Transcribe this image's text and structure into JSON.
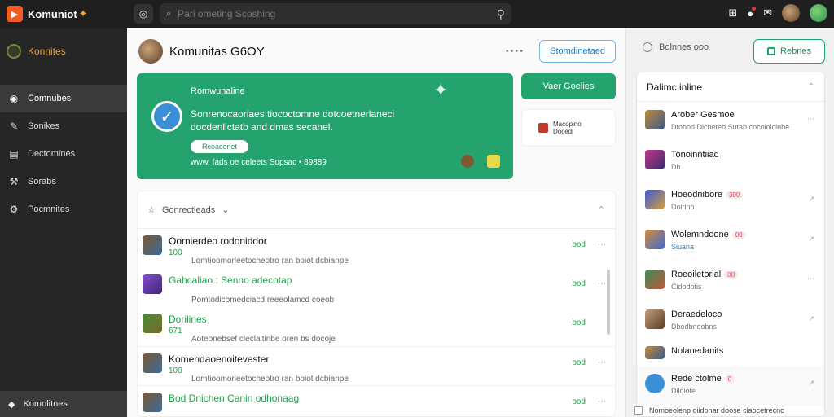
{
  "app": {
    "name": "Komuniot"
  },
  "search": {
    "placeholder": "Pari ometing Scoshing"
  },
  "sidebar": {
    "brand": "Konnites",
    "items": [
      {
        "label": "Comnubes",
        "icon": "globe-icon",
        "active": true
      },
      {
        "label": "Sonikes",
        "icon": "pencil-icon",
        "active": false
      },
      {
        "label": "Dectomines",
        "icon": "document-icon",
        "active": false
      },
      {
        "label": "Sorabs",
        "icon": "wrench-icon",
        "active": false
      },
      {
        "label": "Pocmnites",
        "icon": "gear-icon",
        "active": false
      }
    ],
    "footer": "Komolitnes"
  },
  "main": {
    "title": "Komunitas G6OY",
    "header_button": "Stomdinetaed",
    "banner": {
      "kicker": "Romwunaline",
      "message": "Sonrenocaoriaes tiococtomne dotcoetnerlaneci docdenlictatb and dmas secanel.",
      "pill": "Rcoacenet",
      "meta": "www. fads oe celeets Sopsac • 89889"
    },
    "green_button": "Vaer Goelies",
    "promo": {
      "line1": "Macopino",
      "line2": "Docedi"
    },
    "list": {
      "title": "Gonrectleads",
      "rows": [
        {
          "name": "Oornierdeo rodoniddor",
          "count": "100",
          "sub": "Lomtioomorleetocheotro ran boiot dcbianpe",
          "stat": "bod",
          "green": false
        },
        {
          "name": "Gahcaliao : Senno adecotap",
          "count": "",
          "sub": "Pomtodicomedciacd reeeolamcd coeob",
          "stat": "bod",
          "green": true
        },
        {
          "name": "Dorilines",
          "count": "671",
          "sub": "Aoteonebsef cleclaltinbe oren bs docoje",
          "stat": "bod",
          "green": true
        },
        {
          "name": "Komendaoenoitevester",
          "count": "100",
          "sub": "Lomtioomorleetocheotro ran boiot dcbianpe",
          "stat": "bod",
          "green": false
        },
        {
          "name": "Bod Dnichen Canin odhonaag",
          "count": "",
          "sub": "",
          "stat": "bod",
          "green": true
        }
      ]
    }
  },
  "right": {
    "top_label": "Bolnnes ooo",
    "button": "Rebnes",
    "list_title": "Dalimc inline",
    "items": [
      {
        "name": "Arober Gesmoe",
        "badge": "",
        "sub": "Dtobod Dicheteb Sutab cocoiolcinbe",
        "blue": false
      },
      {
        "name": "Tonoinntiiad",
        "badge": "",
        "sub": "Db",
        "blue": false
      },
      {
        "name": "Hoeodnibore",
        "badge": "300",
        "sub": "Doirino",
        "blue": false
      },
      {
        "name": "Wolemndoone",
        "badge": "00",
        "sub": "Siuana",
        "blue": true
      },
      {
        "name": "Roeoiletorial",
        "badge": "00",
        "sub": "Cidodotis",
        "blue": false
      },
      {
        "name": "Deraedeloco",
        "badge": "",
        "sub": "Dbodbnoobns",
        "blue": false
      },
      {
        "name": "Nolanedanits",
        "badge": "",
        "sub": "",
        "blue": false
      },
      {
        "name": "Rede ctolme",
        "badge": "0",
        "sub": "Diloiote",
        "blue": false
      }
    ],
    "footer": "Nomoeolenp oiidonar doose ciaocetrecnc"
  }
}
